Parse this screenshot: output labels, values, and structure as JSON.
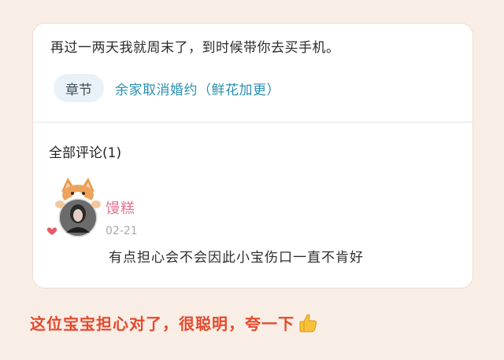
{
  "post": {
    "excerpt": "再过一两天我就周末了，到时候带你去买手机。",
    "chapter_badge": "章节",
    "chapter_link": "余家取消婚约（鲜花加更）"
  },
  "comments": {
    "header": "全部评论(1)",
    "items": [
      {
        "username": "馒糕",
        "date": "02-21",
        "text": "有点担心会不会因此小宝伤口一直不肯好"
      }
    ]
  },
  "caption": {
    "text": "这位宝宝担心对了，很聪明，夸一下",
    "icon": "thumbs-up-icon"
  },
  "colors": {
    "background": "#f9eee6",
    "link": "#2a8fb0",
    "username": "#e0758e",
    "caption": "#e5492c"
  }
}
